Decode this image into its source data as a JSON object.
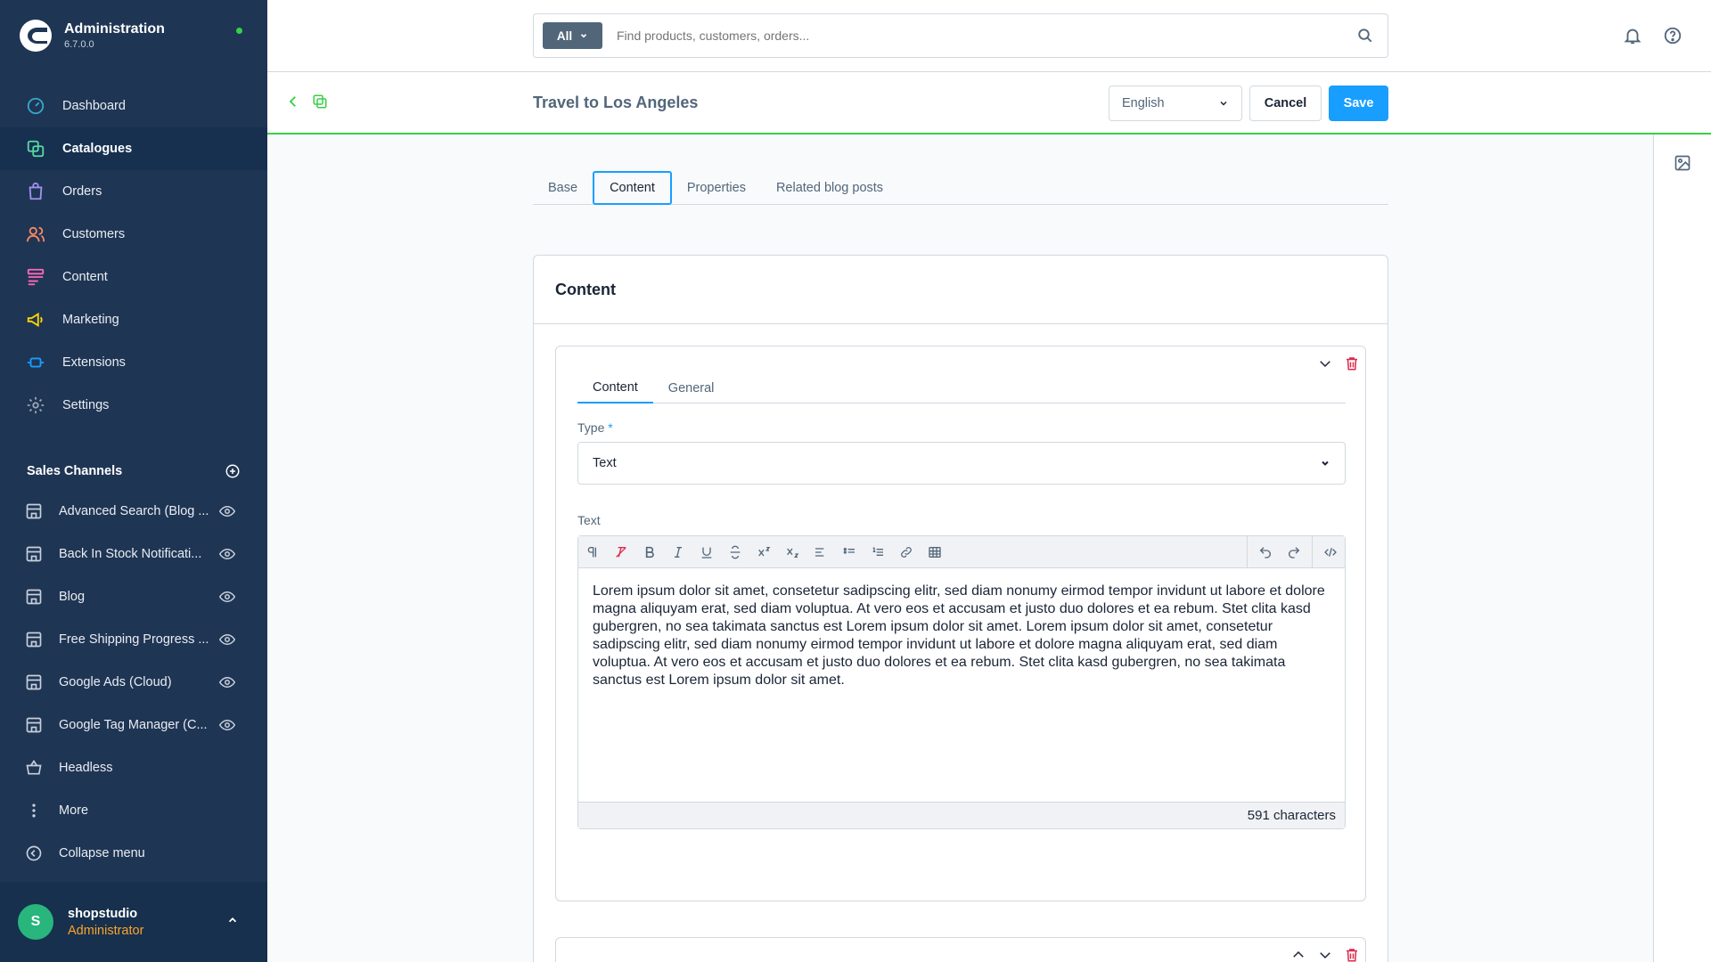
{
  "app": {
    "title": "Administration",
    "version": "6.7.0.0"
  },
  "nav": [
    {
      "label": "Dashboard",
      "icon": "dashboard-icon",
      "color": "#35a7c9"
    },
    {
      "label": "Catalogues",
      "icon": "catalogues-icon",
      "color": "#57d9a3"
    },
    {
      "label": "Orders",
      "icon": "orders-icon",
      "color": "#a092f0"
    },
    {
      "label": "Customers",
      "icon": "customers-icon",
      "color": "#f88962"
    },
    {
      "label": "Content",
      "icon": "content-icon",
      "color": "#ff68b4"
    },
    {
      "label": "Marketing",
      "icon": "marketing-icon",
      "color": "#ffd700"
    },
    {
      "label": "Extensions",
      "icon": "extensions-icon",
      "color": "#189eff"
    },
    {
      "label": "Settings",
      "icon": "settings-icon",
      "color": "#9aa8b5"
    }
  ],
  "sales_channels": {
    "title": "Sales Channels",
    "items": [
      "Advanced Search (Blog ...",
      "Back In Stock Notificati...",
      "Blog",
      "Free Shipping Progress ...",
      "Google Ads (Cloud)",
      "Google Tag Manager (C...",
      "Headless"
    ],
    "more": "More",
    "collapse": "Collapse menu"
  },
  "user": {
    "initial": "S",
    "name": "shopstudio",
    "role": "Administrator"
  },
  "search": {
    "type": "All",
    "placeholder": "Find products, customers, orders..."
  },
  "smartbar": {
    "title": "Travel to Los Angeles",
    "language": "English",
    "cancel": "Cancel",
    "save": "Save"
  },
  "tabs": [
    "Base",
    "Content",
    "Properties",
    "Related blog posts"
  ],
  "card": {
    "title": "Content",
    "inner_tabs": [
      "Content",
      "General"
    ],
    "type_label": "Type",
    "required_mark": "*",
    "type_value": "Text",
    "text_label": "Text",
    "editor_text": "Lorem ipsum dolor sit amet, consetetur sadipscing elitr, sed diam nonumy eirmod tempor invidunt ut labore et dolore magna aliquyam erat, sed diam voluptua. At vero eos et accusam et justo duo dolores et ea rebum. Stet clita kasd gubergren, no sea takimata sanctus est Lorem ipsum dolor sit amet. Lorem ipsum dolor sit amet, consetetur sadipscing elitr, sed diam nonumy eirmod tempor invidunt ut labore et dolore magna aliquyam erat, sed diam voluptua. At vero eos et accusam et justo duo dolores et ea rebum. Stet clita kasd gubergren, no sea takimata sanctus est Lorem ipsum dolor sit amet.",
    "char_count": "591 characters"
  },
  "colors": {
    "sidebar": "#1f3554",
    "accent": "#189eff",
    "online": "#37d046",
    "role": "#ffa32b",
    "delete": "#de294c"
  }
}
